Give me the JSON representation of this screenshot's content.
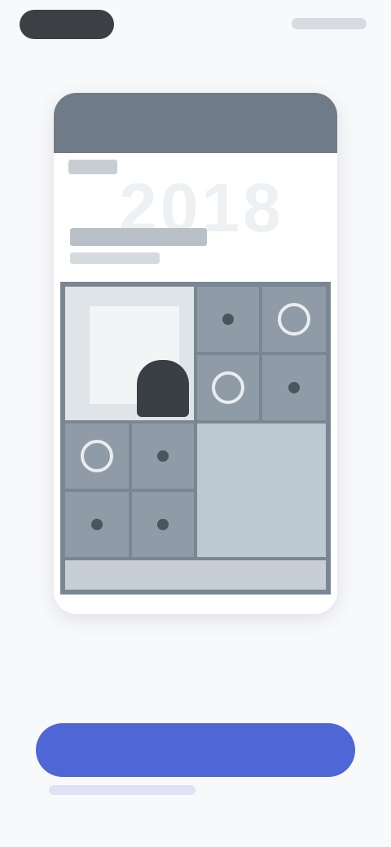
{
  "card": {
    "big_text": "2018"
  },
  "caption": "",
  "cta": {
    "label": ""
  },
  "colors": {
    "accent": "#4f66d6",
    "card_header": "#6f7b86",
    "grid": "#7a8793"
  },
  "icons": [
    "camera-icon",
    "music-icon",
    "play-icon",
    "heart-icon",
    "star-icon",
    "location-icon"
  ]
}
